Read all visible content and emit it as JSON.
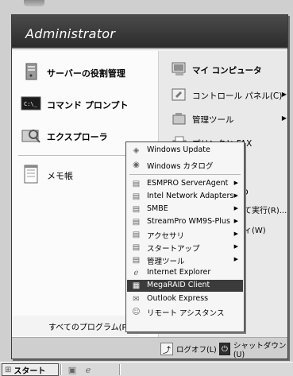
{
  "start_menu": {
    "user_name": "Administrator",
    "pinned": [
      {
        "label": "サーバーの役割管理",
        "icon": "server-icon"
      },
      {
        "label": "コマンド プロンプト",
        "icon": "command-prompt-icon"
      },
      {
        "label": "エクスプローラ",
        "icon": "explorer-icon"
      }
    ],
    "recent": [
      {
        "label": "メモ帳",
        "icon": "notepad-icon"
      }
    ],
    "right_items": [
      {
        "label": "マイ コンピュータ",
        "icon": "computer-icon",
        "arrow": ""
      },
      {
        "label": "コントロール パネル(C)",
        "icon": "control-panel-icon",
        "arrow": "▶"
      },
      {
        "label": "管理ツール",
        "icon": "admin-tools-icon",
        "arrow": "▶"
      },
      {
        "label": "プリンタと FAX",
        "icon": "printer-icon",
        "arrow": ""
      }
    ],
    "right_partial": [
      "て実行(R)...",
      "(W)",
      "ィ"
    ],
    "all_programs": "すべてのプログラム(P)",
    "logoff": "ログオフ(L)",
    "shutdown": "シャットダウン(U)"
  },
  "programs_menu": {
    "top_items": [
      {
        "label": "Windows Update",
        "icon": "windows-update-icon"
      },
      {
        "label": "Windows カタログ",
        "icon": "windows-catalog-icon"
      }
    ],
    "items": [
      {
        "label": "ESMPRO ServerAgent",
        "icon": "folder-icon",
        "arrow": "▶"
      },
      {
        "label": "Intel Network Adapters",
        "icon": "folder-icon",
        "arrow": "▶"
      },
      {
        "label": "SMBE",
        "icon": "folder-icon",
        "arrow": "▶"
      },
      {
        "label": "StreamPro WM9S-Plus",
        "icon": "folder-icon",
        "arrow": "▶"
      },
      {
        "label": "アクセサリ",
        "icon": "folder-icon",
        "arrow": "▶"
      },
      {
        "label": "スタートアップ",
        "icon": "folder-icon",
        "arrow": "▶"
      },
      {
        "label": "管理ツール",
        "icon": "folder-icon",
        "arrow": "▶"
      },
      {
        "label": "Internet Explorer",
        "icon": "internet-explorer-icon",
        "arrow": ""
      },
      {
        "label": "MegaRAID Client",
        "icon": "megaraid-icon",
        "arrow": "",
        "selected": true
      },
      {
        "label": "Outlook Express",
        "icon": "outlook-icon",
        "arrow": ""
      },
      {
        "label": "リモート アシスタンス",
        "icon": "remote-assistance-icon",
        "arrow": ""
      }
    ]
  },
  "taskbar": {
    "start_label": "スタート"
  }
}
